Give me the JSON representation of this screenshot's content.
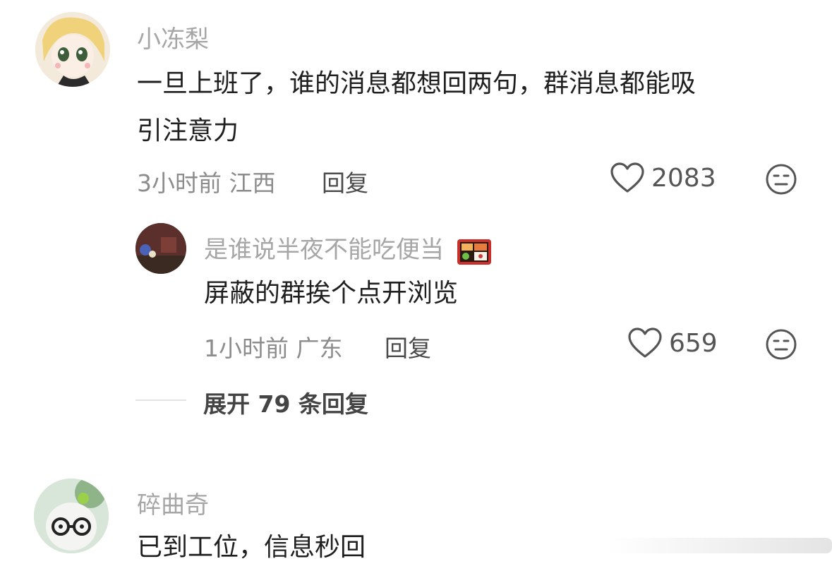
{
  "comments": [
    {
      "username": "小冻梨",
      "text_line1": "一旦上班了，谁的消息都想回两句，群消息都能吸",
      "text_line2": "引注意力",
      "time": "3小时前",
      "location": "江西",
      "reply_label": "回复",
      "likes": "2083",
      "reply": {
        "username": "是谁说半夜不能吃便当",
        "username_emoji": "bento-icon",
        "text": "屏蔽的群挨个点开浏览",
        "time": "1小时前",
        "location": "广东",
        "reply_label": "回复",
        "likes": "659"
      },
      "expand_label": "展开 79 条回复"
    },
    {
      "username": "碎曲奇",
      "text_line1": "已到工位，信息秒回"
    }
  ],
  "colors": {
    "name": "#a6a6a6",
    "text": "#1f1f1f",
    "meta": "#8c8c8c",
    "icon": "#555555"
  }
}
